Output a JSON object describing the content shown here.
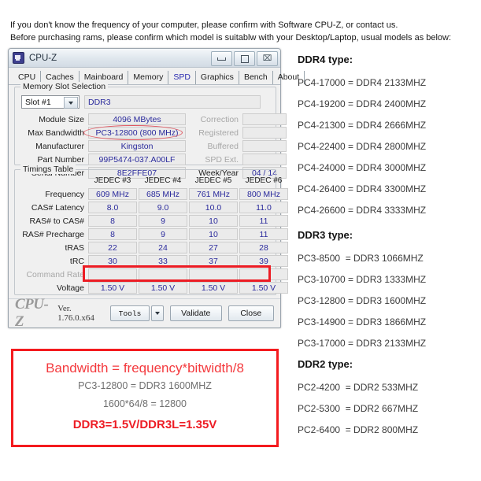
{
  "intro": {
    "line1": "If you don't know the frequency of your computer, please confirm with Software CPU-Z, or contact us.",
    "line2": "Before purchasing rams, please confirm which model is suitablw with your Desktop/Laptop, usual models as below:"
  },
  "window": {
    "title": "CPU-Z",
    "minimize_label": "",
    "maximize_label": "",
    "close_label": "⌧",
    "tabs": [
      {
        "label": "CPU",
        "active": false
      },
      {
        "label": "Caches",
        "active": false
      },
      {
        "label": "Mainboard",
        "active": false
      },
      {
        "label": "Memory",
        "active": false
      },
      {
        "label": "SPD",
        "active": true
      },
      {
        "label": "Graphics",
        "active": false
      },
      {
        "label": "Bench",
        "active": false
      },
      {
        "label": "About",
        "active": false
      }
    ],
    "slot_group": {
      "title": "Memory Slot Selection",
      "slot_selected": "Slot #1",
      "memory_type": "DDR3",
      "left_fields": [
        {
          "label": "Module Size",
          "value": "4096 MBytes"
        },
        {
          "label": "Max Bandwidth",
          "value": "PC3-12800 (800 MHz)"
        },
        {
          "label": "Manufacturer",
          "value": "Kingston"
        },
        {
          "label": "Part Number",
          "value": "99P5474-037.A00LF"
        },
        {
          "label": "Serial Number",
          "value": "8E2FFE07"
        }
      ],
      "right_fields": [
        {
          "label": "Correction",
          "value": "",
          "disabled": true
        },
        {
          "label": "Registered",
          "value": "",
          "disabled": true
        },
        {
          "label": "Buffered",
          "value": "",
          "disabled": true
        },
        {
          "label": "SPD Ext.",
          "value": "",
          "disabled": true
        },
        {
          "label": "Week/Year",
          "value": "04 / 14",
          "disabled": false
        }
      ]
    },
    "timings_group": {
      "title": "Timings Table",
      "columns": [
        "JEDEC #3",
        "JEDEC #4",
        "JEDEC #5",
        "JEDEC #6"
      ],
      "rows": [
        {
          "label": "Frequency",
          "disabled": false,
          "values": [
            "609 MHz",
            "685 MHz",
            "761 MHz",
            "800 MHz"
          ]
        },
        {
          "label": "CAS# Latency",
          "disabled": false,
          "values": [
            "8.0",
            "9.0",
            "10.0",
            "11.0"
          ]
        },
        {
          "label": "RAS# to CAS#",
          "disabled": false,
          "values": [
            "8",
            "9",
            "10",
            "11"
          ]
        },
        {
          "label": "RAS# Precharge",
          "disabled": false,
          "values": [
            "8",
            "9",
            "10",
            "11"
          ]
        },
        {
          "label": "tRAS",
          "disabled": false,
          "values": [
            "22",
            "24",
            "27",
            "28"
          ]
        },
        {
          "label": "tRC",
          "disabled": false,
          "values": [
            "30",
            "33",
            "37",
            "39"
          ]
        },
        {
          "label": "Command Rate",
          "disabled": true,
          "values": [
            "",
            "",
            "",
            ""
          ]
        },
        {
          "label": "Voltage",
          "disabled": false,
          "values": [
            "1.50 V",
            "1.50 V",
            "1.50 V",
            "1.50 V"
          ]
        }
      ]
    },
    "footer": {
      "brand": "CPU-Z",
      "version": "Ver. 1.76.0.x64",
      "tools_label": "Tools",
      "validate_label": "Validate",
      "close_label": "Close"
    }
  },
  "annotation": {
    "line1": "Bandwidth = frequency*bitwidth/8",
    "line2": "PC3-12800 = DDR3 1600MHZ",
    "line3": "1600*64/8 = 12800",
    "line4": "DDR3=1.5V/DDR3L=1.35V"
  },
  "reference": {
    "ddr4": {
      "heading": "DDR4 type:",
      "items": [
        "PC4-17000 = DDR4 2133MHZ",
        "PC4-19200 = DDR4 2400MHZ",
        "PC4-21300 = DDR4 2666MHZ",
        "PC4-22400 = DDR4 2800MHZ",
        "PC4-24000 = DDR4 3000MHZ",
        "PC4-26400 = DDR4 3300MHZ",
        "PC4-26600 = DDR4 3333MHZ"
      ]
    },
    "ddr3": {
      "heading": "DDR3 type:",
      "items": [
        "PC3-8500  = DDR3 1066MHZ",
        "PC3-10700 = DDR3 1333MHZ",
        "PC3-12800 = DDR3 1600MHZ",
        "PC3-14900 = DDR3 1866MHZ",
        "PC3-17000 = DDR3 2133MHZ"
      ]
    },
    "ddr2": {
      "heading": "DDR2 type:",
      "items": [
        "PC2-4200  = DDR2 533MHZ",
        "PC2-5300  = DDR2 667MHZ",
        "PC2-6400  = DDR2 800MHZ"
      ]
    }
  },
  "colors": {
    "accent_red": "#ed1c24",
    "field_text": "#2a2a9c",
    "tab_active": "#2a2ab0"
  }
}
